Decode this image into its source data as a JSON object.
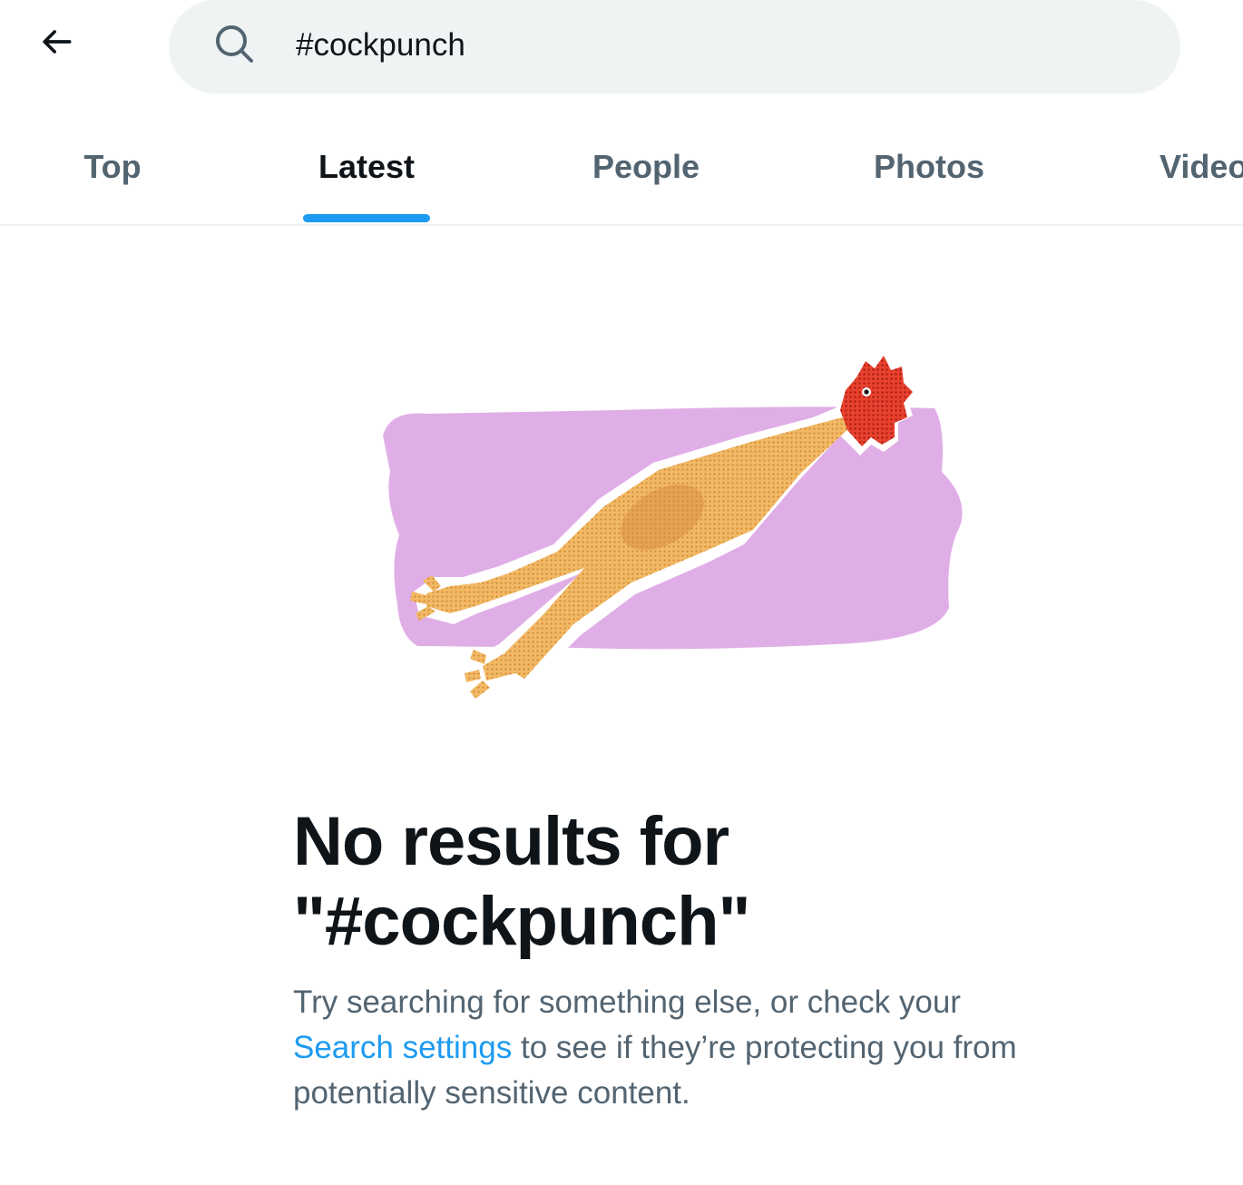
{
  "header": {
    "search_value": "#cockpunch"
  },
  "tabs": [
    {
      "label": "Top",
      "active": false
    },
    {
      "label": "Latest",
      "active": true
    },
    {
      "label": "People",
      "active": false
    },
    {
      "label": "Photos",
      "active": false
    },
    {
      "label": "Videos",
      "active": false
    }
  ],
  "colors": {
    "accent": "#1d9bf0",
    "text_primary": "#0f1419",
    "text_secondary": "#536471",
    "search_bg": "#eff3f4",
    "illustration_bg": "#e0aee6"
  },
  "icons": {
    "back": "arrow-left-icon",
    "search": "search-icon"
  },
  "empty_state": {
    "title_line1": "No results for",
    "title_line2": "\"#cockpunch\"",
    "desc_prefix": "Try searching for something else, or check your",
    "desc_link": "Search settings",
    "desc_suffix": " to see if they’re protecting you from potentially sensitive content."
  }
}
